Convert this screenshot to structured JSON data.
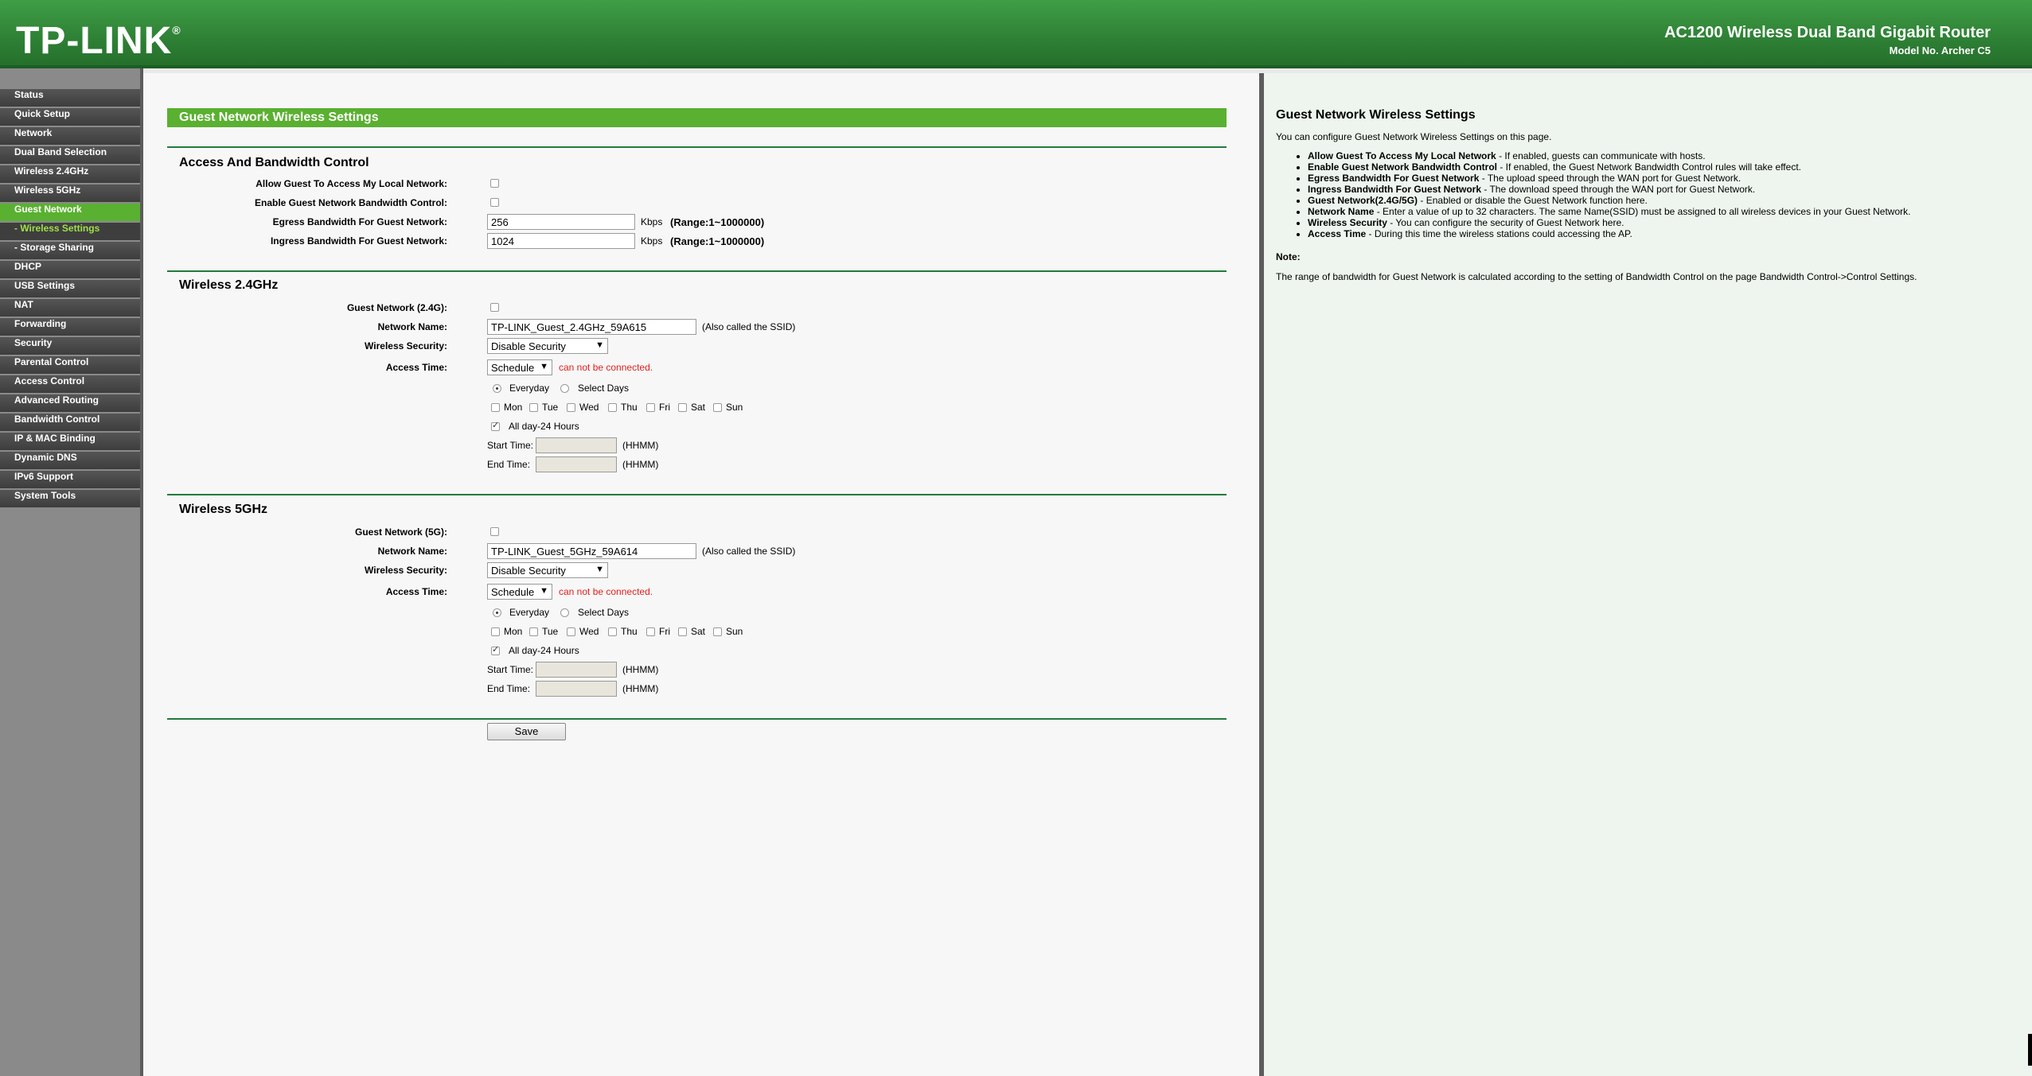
{
  "header": {
    "logo": "TP-LINK",
    "logo_mark": "®",
    "title": "AC1200 Wireless Dual Band Gigabit Router",
    "model": "Model No. Archer C5"
  },
  "menu": [
    {
      "label": "Status"
    },
    {
      "label": "Quick Setup"
    },
    {
      "label": "Network"
    },
    {
      "label": "Dual Band Selection"
    },
    {
      "label": "Wireless 2.4GHz"
    },
    {
      "label": "Wireless 5GHz"
    },
    {
      "label": "Guest Network"
    },
    {
      "label": "- Wireless Settings"
    },
    {
      "label": "- Storage Sharing"
    },
    {
      "label": "DHCP"
    },
    {
      "label": "USB Settings"
    },
    {
      "label": "NAT"
    },
    {
      "label": "Forwarding"
    },
    {
      "label": "Security"
    },
    {
      "label": "Parental Control"
    },
    {
      "label": "Access Control"
    },
    {
      "label": "Advanced Routing"
    },
    {
      "label": "Bandwidth Control"
    },
    {
      "label": "IP & MAC Binding"
    },
    {
      "label": "Dynamic DNS"
    },
    {
      "label": "IPv6 Support"
    },
    {
      "label": "System Tools"
    }
  ],
  "page": {
    "title": "Guest Network Wireless Settings",
    "access": {
      "heading": "Access And Bandwidth Control",
      "allow_label": "Allow Guest To Access My Local Network:",
      "enable_label": "Enable Guest Network Bandwidth Control:",
      "egress_label": "Egress Bandwidth For Guest Network:",
      "egress_value": "256",
      "ingress_label": "Ingress Bandwidth For Guest Network:",
      "ingress_value": "1024",
      "unit": "Kbps",
      "range": "(Range:1~1000000)"
    },
    "w24": {
      "heading": "Wireless 2.4GHz",
      "guest_label": "Guest Network (2.4G):",
      "name_label": "Network Name:",
      "name_value": "TP-LINK_Guest_2.4GHz_59A615",
      "ssid_note": "(Also called the SSID)",
      "security_label": "Wireless Security:",
      "security_value": "Disable Security",
      "access_label": "Access Time:",
      "access_value": "Schedule",
      "warning": "can not be connected.",
      "everyday": "Everyday",
      "select_days": "Select Days",
      "days": [
        "Mon",
        "Tue",
        "Wed",
        "Thu",
        "Fri",
        "Sat",
        "Sun"
      ],
      "allday": "All day-24 Hours",
      "start_label": "Start Time:",
      "end_label": "End Time:",
      "hhmm": "(HHMM)"
    },
    "w5": {
      "heading": "Wireless 5GHz",
      "guest_label": "Guest Network (5G):",
      "name_label": "Network Name:",
      "name_value": "TP-LINK_Guest_5GHz_59A614",
      "ssid_note": "(Also called the SSID)",
      "security_label": "Wireless Security:",
      "security_value": "Disable Security",
      "access_label": "Access Time:",
      "access_value": "Schedule",
      "warning": "can not be connected.",
      "everyday": "Everyday",
      "select_days": "Select Days",
      "days": [
        "Mon",
        "Tue",
        "Wed",
        "Thu",
        "Fri",
        "Sat",
        "Sun"
      ],
      "allday": "All day-24 Hours",
      "start_label": "Start Time:",
      "end_label": "End Time:",
      "hhmm": "(HHMM)"
    },
    "save": "Save"
  },
  "help": {
    "title": "Guest Network Wireless Settings",
    "intro": "You can configure Guest Network Wireless Settings on this page.",
    "items": [
      {
        "term": "Allow Guest To Access My Local Network",
        "desc": " - If enabled, guests can communicate with hosts."
      },
      {
        "term": "Enable Guest Network Bandwidth Control",
        "desc": " - If enabled, the Guest Network Bandwidth Control rules will take effect."
      },
      {
        "term": "Egress Bandwidth For Guest Network",
        "desc": " - The upload speed through the WAN port for Guest Network."
      },
      {
        "term": "Ingress Bandwidth For Guest Network",
        "desc": " - The download speed through the WAN port for Guest Network."
      },
      {
        "term": "Guest Network(2.4G/5G)",
        "desc": " - Enabled or disable the Guest Network function here."
      },
      {
        "term": "Network Name",
        "desc": " - Enter a value of up to 32 characters. The same Name(SSID) must be assigned to all wireless devices in your Guest Network."
      },
      {
        "term": "Wireless Security",
        "desc": " - You can configure the security of Guest Network here."
      },
      {
        "term": "Access Time",
        "desc": " - During this time the wireless stations could accessing the AP."
      }
    ],
    "note_label": "Note:",
    "note": "The range of bandwidth for Guest Network is calculated according to the setting of Bandwidth Control on the page Bandwidth Control->Control Settings."
  }
}
